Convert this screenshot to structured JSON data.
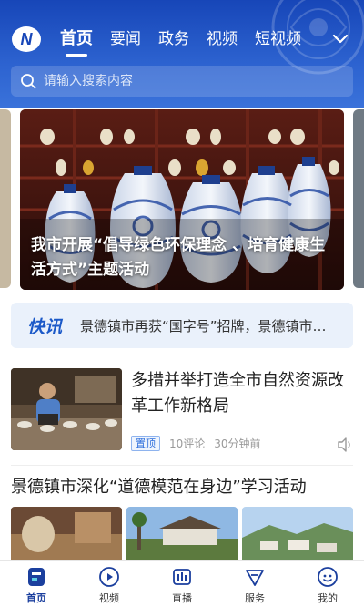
{
  "header": {
    "logo_letter": "N",
    "nav": [
      {
        "label": "首页",
        "active": true
      },
      {
        "label": "要闻",
        "active": false
      },
      {
        "label": "政务",
        "active": false
      },
      {
        "label": "视频",
        "active": false
      },
      {
        "label": "短视频",
        "active": false
      }
    ],
    "expand_icon": "chevron-down-icon"
  },
  "search": {
    "placeholder": "请输入搜索内容",
    "icon": "search-icon"
  },
  "hero": {
    "caption": "我市开展“倡导绿色环保理念 、培育健康生活方式”主题活动"
  },
  "flash": {
    "tag": "快讯",
    "text": "景德镇市再获“国字号”招牌，景德镇市…"
  },
  "article1": {
    "title": "多措并举打造全市自然资源改革工作新格局",
    "pin_label": "置顶",
    "comments": "10评论",
    "time": "30分钟前",
    "icon": "speaker-icon"
  },
  "article2": {
    "title": "景德镇市深化“道德模范在身边”学习活动"
  },
  "tabbar": [
    {
      "label": "首页",
      "icon": "home-icon",
      "active": true
    },
    {
      "label": "视频",
      "icon": "play-icon",
      "active": false
    },
    {
      "label": "直播",
      "icon": "live-icon",
      "active": false
    },
    {
      "label": "服务",
      "icon": "service-icon",
      "active": false
    },
    {
      "label": "我的",
      "icon": "profile-icon",
      "active": false
    }
  ],
  "colors": {
    "brand_blue": "#1b59c8",
    "header_top": "#1746b8",
    "tab_active": "#1b3f9e"
  }
}
